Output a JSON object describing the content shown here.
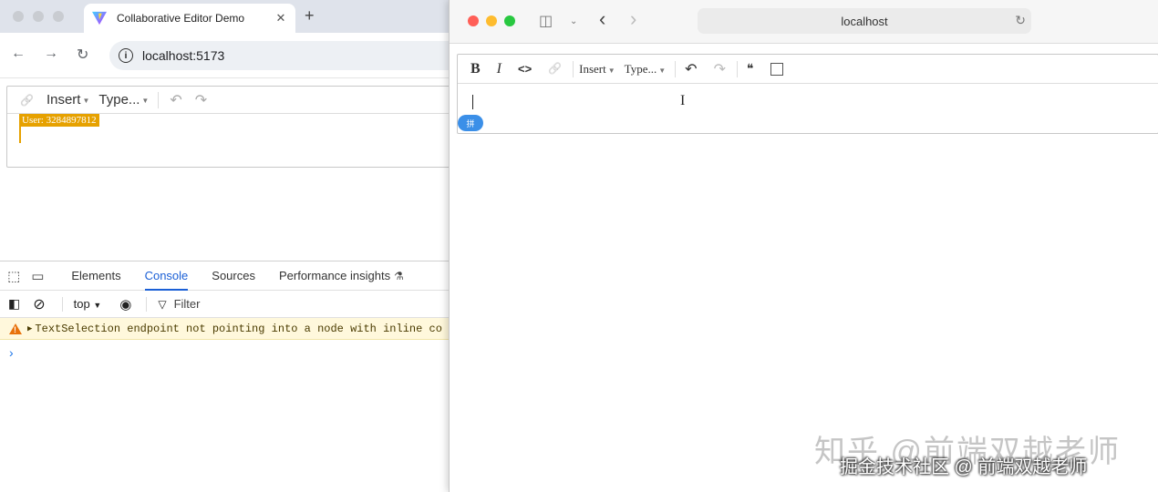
{
  "chrome": {
    "tab_title": "Collaborative Editor Demo",
    "tab_close": "✕",
    "new_tab": "+",
    "back": "←",
    "forward": "→",
    "reload": "↻",
    "url": "localhost:5173",
    "info_icon": "i"
  },
  "left_editor": {
    "link_icon": "🔗",
    "insert_label": "Insert",
    "type_label": "Type...",
    "undo_icon": "↶",
    "redo_icon": "↷",
    "collab_user": "User: 3284897812",
    "collab_color": "#e6a100"
  },
  "devtools": {
    "tabs": [
      "Elements",
      "Console",
      "Sources",
      "Performance insights"
    ],
    "active_tab": "Console",
    "flask_icon": "⚗",
    "context": "top",
    "filter_label": "Filter",
    "message": "TextSelection endpoint not pointing into a node with inline co",
    "message_type": "warning",
    "prompt": "›"
  },
  "safari": {
    "url": "localhost",
    "back": "‹",
    "forward": "›",
    "reload": "↻"
  },
  "right_editor": {
    "bold": "B",
    "italic": "I",
    "code": "<>",
    "link_icon": "🔗",
    "insert_label": "Insert",
    "type_label": "Type...",
    "undo_icon": "↶",
    "redo_icon": "↷",
    "quote_icon": "❝",
    "ime_badge": "拼"
  },
  "watermark": {
    "line1": "知乎 @前端双越老师",
    "line2": "掘金技术社区 @ 前端双越老师"
  }
}
